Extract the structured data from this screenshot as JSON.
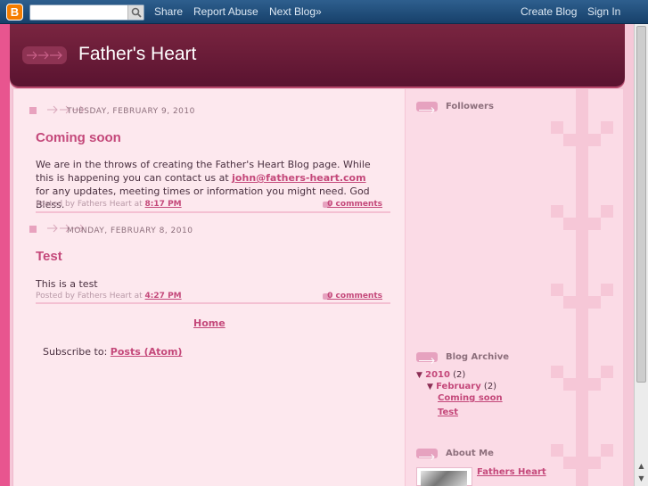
{
  "navbar": {
    "logo_letter": "B",
    "search": {
      "value": "",
      "placeholder": ""
    },
    "links": {
      "share": "Share",
      "report_abuse": "Report Abuse",
      "next_blog": "Next Blog»",
      "create_blog": "Create Blog",
      "sign_in": "Sign In"
    }
  },
  "blog": {
    "title": "Father's Heart"
  },
  "posts": [
    {
      "date": "TUESDAY, FEBRUARY 9, 2010",
      "title": "Coming soon",
      "body_before": "We are in the throws of creating the Father's Heart Blog page. While this is happening you can contact us at ",
      "email": "john@fathers-heart.com",
      "body_after": " for any updates, meeting times or information you might need. God Bless.",
      "posted_by": "Posted by Fathers Heart at ",
      "time": "8:17 PM",
      "comments": "0 comments"
    },
    {
      "date": "MONDAY, FEBRUARY 8, 2010",
      "title": "Test",
      "body": "This is a test",
      "posted_by": "Posted by Fathers Heart at ",
      "time": "4:27 PM",
      "comments": "0 comments"
    }
  ],
  "home_link": "Home",
  "subscribe": {
    "label": "Subscribe to: ",
    "link": "Posts (Atom)"
  },
  "sidebar": {
    "followers_title": "Followers",
    "archive": {
      "title": "Blog Archive",
      "year_toggle": "▼",
      "year": "2010",
      "year_count": "(2)",
      "month_toggle": "▼",
      "month": "February",
      "month_count": "(2)",
      "posts": [
        "Coming soon",
        "Test"
      ]
    },
    "about": {
      "title": "About Me",
      "name": "Fathers Heart"
    }
  },
  "colors": {
    "navbar": "#1e4a75",
    "header": "#6a1b38",
    "accent": "#c4487a",
    "page_bg": "#e8558f"
  }
}
